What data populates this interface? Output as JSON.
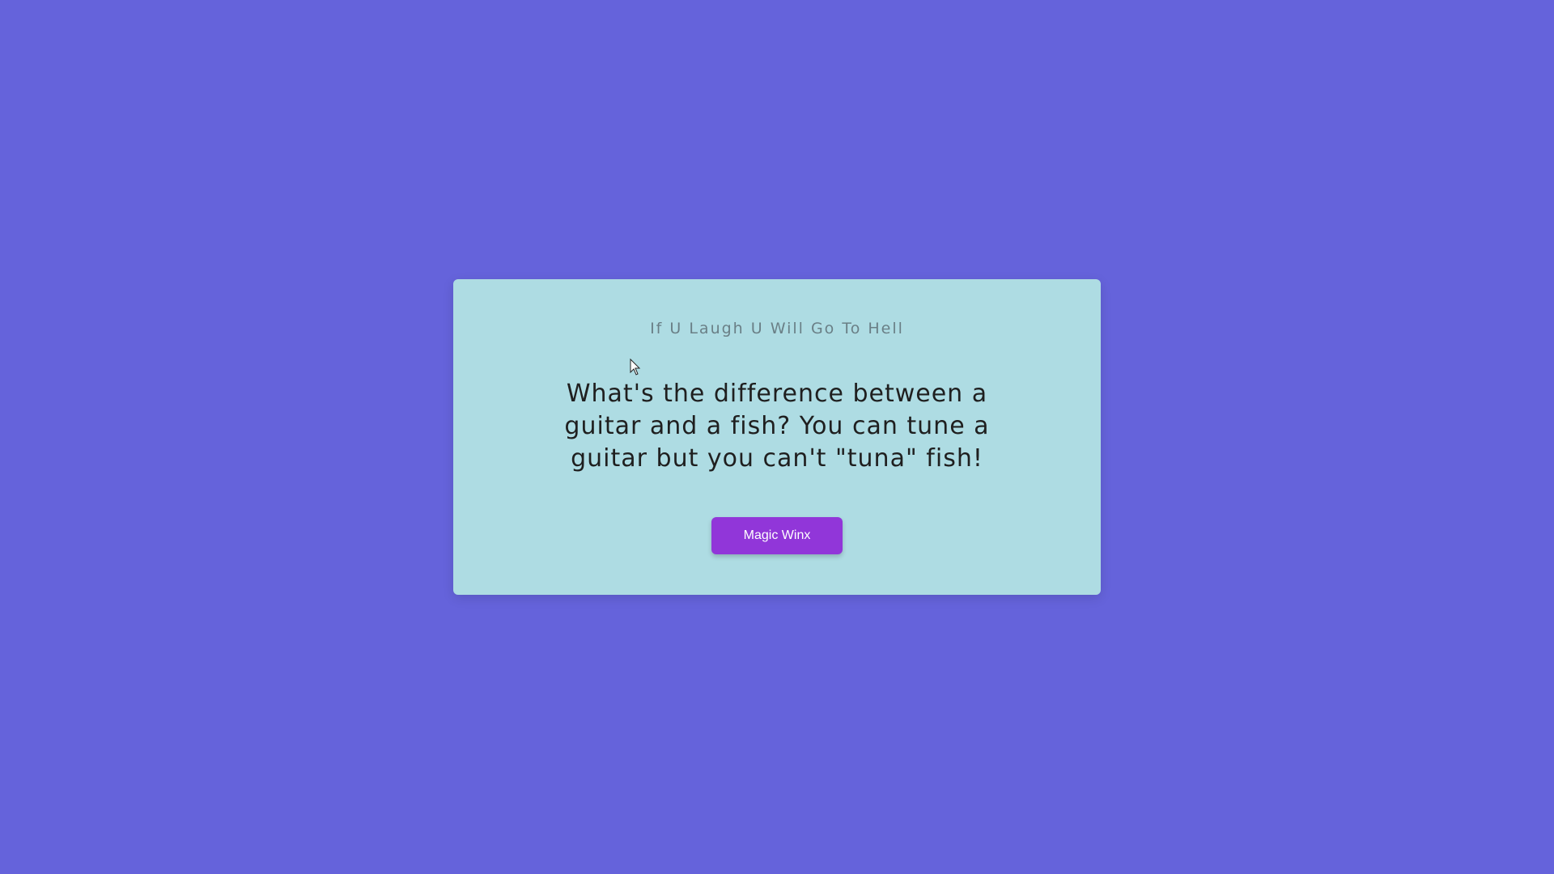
{
  "card": {
    "title": "If U Laugh U Will Go To Hell",
    "joke": "What's the difference between a guitar and a fish? You can tune a guitar but you can't \"tuna\" fish!",
    "button_label": "Magic Winx"
  },
  "colors": {
    "background": "#6563db",
    "card": "#aedce3",
    "button": "#9136d9"
  },
  "icons": {
    "cursor": "mouse-pointer-icon"
  }
}
